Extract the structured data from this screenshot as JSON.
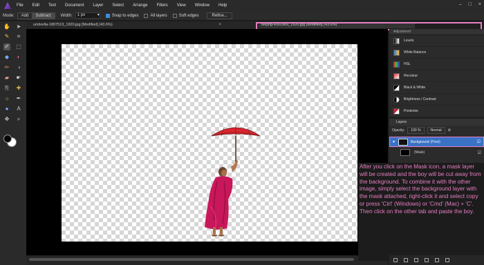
{
  "menu": [
    "File",
    "Edit",
    "Text",
    "Document",
    "Layer",
    "Select",
    "Arrange",
    "Filters",
    "View",
    "Window",
    "Help"
  ],
  "context_toolbar": {
    "mode_label": "Mode:",
    "modes": [
      "Add",
      "Subtract"
    ],
    "width_label": "Width:",
    "width_value": "1 px",
    "snap_to_edges": "Snap to edges",
    "all_layers": "All layers",
    "soft_edges": "Soft edges",
    "refine": "Refine..."
  },
  "tabs": [
    {
      "title": "umbrella-1807513_1920.jpg [Modified] (43.6%)"
    },
    {
      "title": "beijing-4361969_1920.jpg [Modified] (43.6%)"
    }
  ],
  "adjustments": {
    "header": "Adjustment",
    "items": [
      "Levels",
      "White Balance",
      "HSL",
      "Recolour",
      "Black & White",
      "Brightness / Contrast",
      "Posterise"
    ]
  },
  "layers": {
    "header": "Layers",
    "opacity_label": "Opacity:",
    "opacity_value": "100 %",
    "blend_mode": "Normal",
    "background_name": "Background",
    "background_type": "(Pixel)",
    "mask_name": "(Mask)"
  },
  "note": "After you click on the Mask icon, a mask  layer will be created and the boy will be cut away from the background. To combine it with the other image, simply select the background layer with the mask attached, right-click it and select copy or press 'Ctrl' (Windows) or 'Cmd' (Mac) + 'C'. Then click on the other tab and paste the boy.",
  "colors": {
    "accent": "#3a72c6",
    "highlight": "#e87fc4",
    "umbrella": "#d8262f",
    "robe": "#c8175a"
  }
}
